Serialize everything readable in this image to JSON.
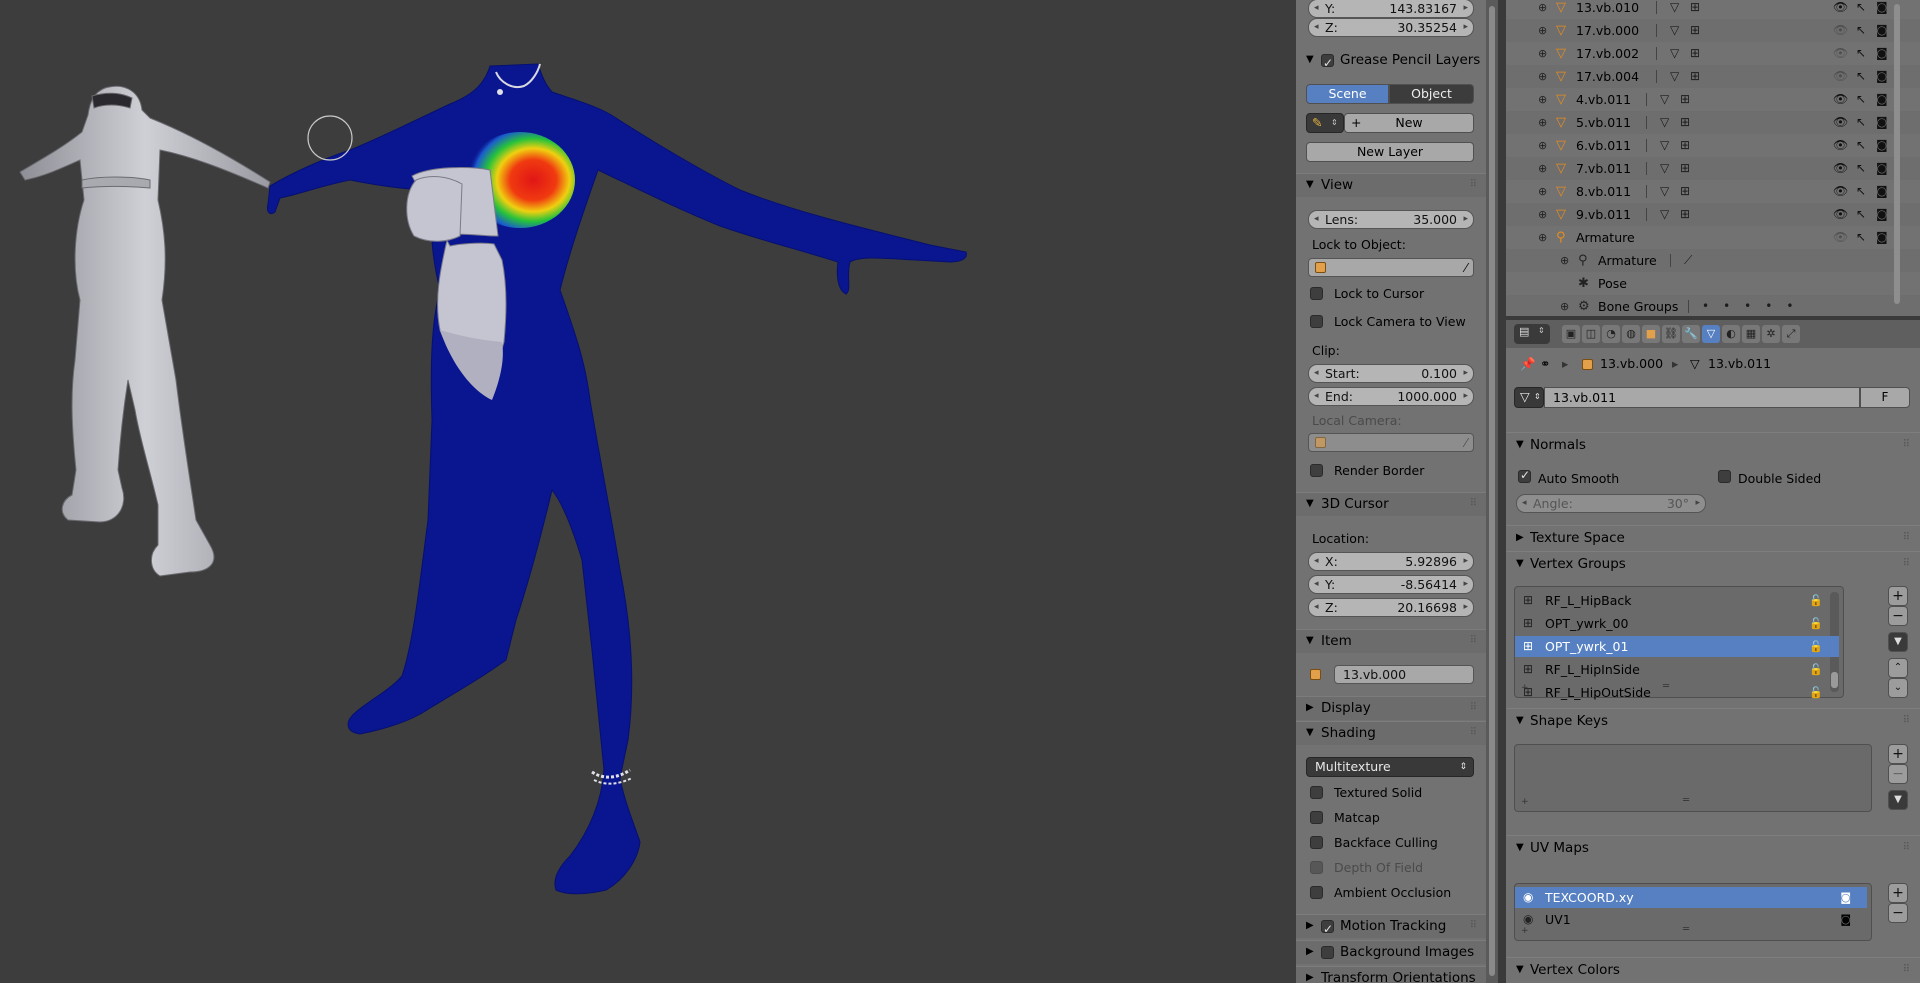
{
  "outliner": {
    "rows": [
      {
        "name": "13.vb.010",
        "type": "mesh"
      },
      {
        "name": "17.vb.000",
        "type": "mesh"
      },
      {
        "name": "17.vb.002",
        "type": "mesh"
      },
      {
        "name": "17.vb.004",
        "type": "mesh"
      },
      {
        "name": "4.vb.011",
        "type": "mesh"
      },
      {
        "name": "5.vb.011",
        "type": "mesh"
      },
      {
        "name": "6.vb.011",
        "type": "mesh"
      },
      {
        "name": "7.vb.011",
        "type": "mesh"
      },
      {
        "name": "8.vb.011",
        "type": "mesh"
      },
      {
        "name": "9.vb.011",
        "type": "mesh"
      },
      {
        "name": "Armature",
        "type": "armature"
      },
      {
        "name": "Armature",
        "type": "armature-data"
      },
      {
        "name": "Pose",
        "type": "pose"
      },
      {
        "name": "Bone Groups",
        "type": "bone-groups"
      }
    ]
  },
  "npanel": {
    "loc_y": {
      "label": "Y:",
      "value": "143.83167"
    },
    "loc_z": {
      "label": "Z:",
      "value": "30.35254"
    },
    "grease_pencil": {
      "title": "Grease Pencil Layers",
      "scene_btn": "Scene",
      "object_btn": "Object",
      "new_btn": "New",
      "new_layer_btn": "New Layer"
    },
    "view": {
      "title": "View",
      "lens_label": "Lens:",
      "lens_value": "35.000",
      "lock_to_object": "Lock to Object:",
      "lock_to_cursor": "Lock to Cursor",
      "lock_camera_to_view": "Lock Camera to View",
      "clip": "Clip:",
      "clip_start_label": "Start:",
      "clip_start_value": "0.100",
      "clip_end_label": "End:",
      "clip_end_value": "1000.000",
      "local_camera": "Local Camera:",
      "render_border": "Render Border"
    },
    "cursor": {
      "title": "3D Cursor",
      "location": "Location:",
      "x_label": "X:",
      "x_value": "5.92896",
      "y_label": "Y:",
      "y_value": "-8.56414",
      "z_label": "Z:",
      "z_value": "20.16698"
    },
    "item": {
      "title": "Item",
      "name": "13.vb.000"
    },
    "display": {
      "title": "Display"
    },
    "shading": {
      "title": "Shading",
      "mode": "Multitexture",
      "textured_solid": "Textured Solid",
      "matcap": "Matcap",
      "backface_culling": "Backface Culling",
      "depth_of_field": "Depth Of Field",
      "ambient_occlusion": "Ambient Occlusion"
    },
    "motion_tracking": "Motion Tracking",
    "background_images": "Background Images",
    "transform_orientations": "Transform Orientations"
  },
  "properties": {
    "breadcrumb_object": "13.vb.000",
    "breadcrumb_data": "13.vb.011",
    "datablock_name": "13.vb.011",
    "fake_user": "F",
    "normals": {
      "title": "Normals",
      "auto_smooth": "Auto Smooth",
      "double_sided": "Double Sided",
      "angle_label": "Angle:",
      "angle_value": "30°"
    },
    "texture_space": "Texture Space",
    "vertex_groups": {
      "title": "Vertex Groups",
      "items": [
        "RF_L_HipBack",
        "OPT_ywrk_00",
        "OPT_ywrk_01",
        "RF_L_HipInSide",
        "RF_L_HipOutSide"
      ],
      "selected_index": 2
    },
    "shape_keys": {
      "title": "Shape Keys"
    },
    "uv_maps": {
      "title": "UV Maps",
      "items": [
        "TEXCOORD.xy",
        "UV1"
      ],
      "selected_index": 0
    },
    "vertex_colors": {
      "title": "Vertex Colors"
    }
  },
  "colors": {
    "selection_blue": "#5680c2",
    "panel_gray": "#727272",
    "viewport_bg": "#3d3d3d",
    "mesh_blue": "#0a168f",
    "mesh_gray": "#bcbcc4"
  }
}
